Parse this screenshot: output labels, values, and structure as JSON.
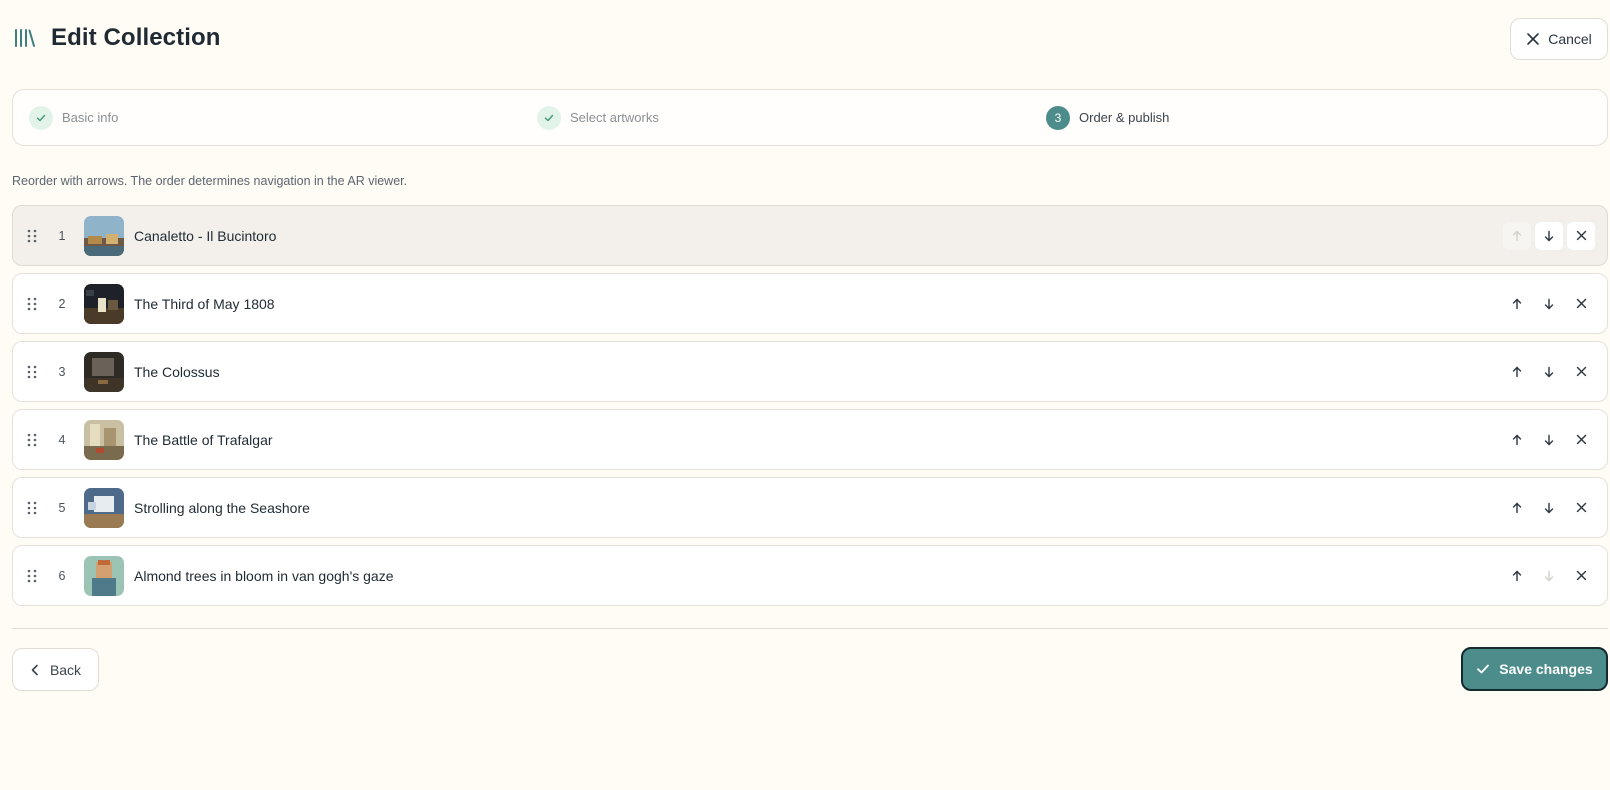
{
  "header": {
    "title": "Edit Collection",
    "cancel_label": "Cancel"
  },
  "stepper": {
    "steps": [
      {
        "label": "Basic info",
        "state": "done"
      },
      {
        "label": "Select artworks",
        "state": "done"
      },
      {
        "number": "3",
        "label": "Order & publish",
        "state": "active"
      }
    ]
  },
  "hint": "Reorder with arrows. The order determines navigation in the AR viewer.",
  "artworks": [
    {
      "index": "1",
      "title": "Canaletto - Il Bucintoro",
      "selected": true,
      "up_disabled": true,
      "down_disabled": false
    },
    {
      "index": "2",
      "title": "The Third of May 1808",
      "selected": false,
      "up_disabled": false,
      "down_disabled": false
    },
    {
      "index": "3",
      "title": "The Colossus",
      "selected": false,
      "up_disabled": false,
      "down_disabled": false
    },
    {
      "index": "4",
      "title": "The Battle of Trafalgar",
      "selected": false,
      "up_disabled": false,
      "down_disabled": false
    },
    {
      "index": "5",
      "title": "Strolling along the Seashore",
      "selected": false,
      "up_disabled": false,
      "down_disabled": false
    },
    {
      "index": "6",
      "title": "Almond trees in bloom in van gogh's gaze",
      "selected": false,
      "up_disabled": false,
      "down_disabled": true
    }
  ],
  "footer": {
    "back_label": "Back",
    "save_label": "Save changes"
  },
  "colors": {
    "accent": "#4c8d8b",
    "background": "#fffbf5"
  }
}
